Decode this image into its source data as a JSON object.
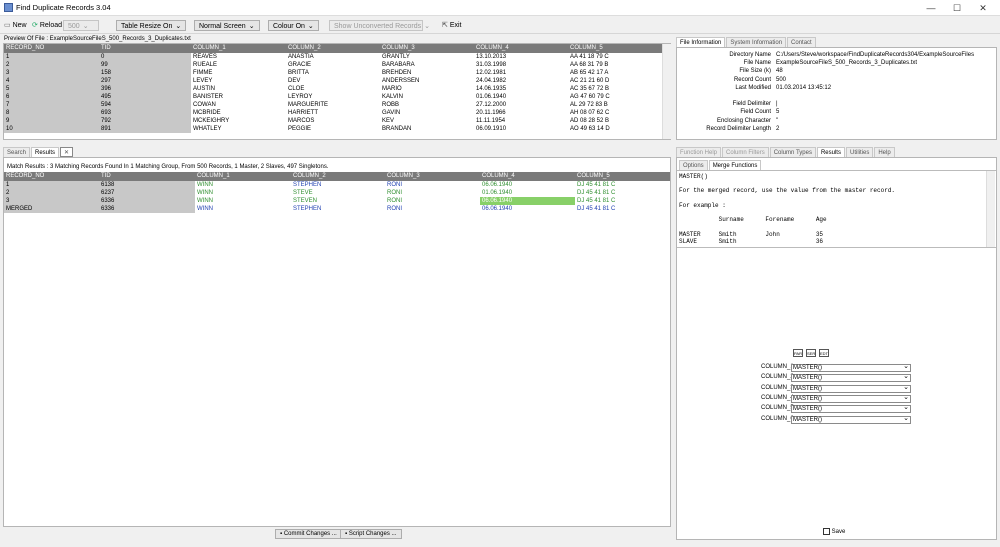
{
  "window": {
    "title": "Find Duplicate Records 3.04",
    "min": "—",
    "max": "☐",
    "close": "✕"
  },
  "toolbar": {
    "new": "New",
    "reload": "Reload",
    "reload_count": "500",
    "table_resize": "Table Resize On",
    "screen": "Normal Screen",
    "colour": "Colour On",
    "unconverted": "Show Unconverted Records",
    "exit": "Exit"
  },
  "preview": {
    "caption": "Preview Of File : ExampleSourceFileS_500_Records_3_Duplicates.txt",
    "columns": [
      "RECORD_NO",
      "TID",
      "COLUMN_1",
      "COLUMN_2",
      "COLUMN_3",
      "COLUMN_4",
      "COLUMN_5"
    ],
    "rows": [
      [
        "1",
        "0",
        "REAVES",
        "ANASTIA",
        "GRANTLY",
        "13.10.2013",
        "AA 41 18 79 C"
      ],
      [
        "2",
        "99",
        "RUEALE",
        "GRACIE",
        "BARABARA",
        "31.03.1998",
        "AA 68 31 79 B"
      ],
      [
        "3",
        "158",
        "FIMME",
        "BRITTA",
        "BREHDEN",
        "12.02.1981",
        "AB 65 42 17 A"
      ],
      [
        "4",
        "297",
        "LEVEY",
        "DEV",
        "ANDERSSEN",
        "24.04.1982",
        "AC 21 21 60 D"
      ],
      [
        "5",
        "396",
        "AUSTIN",
        "CLOE",
        "MARIO",
        "14.06.1935",
        "AC 35 67 72 B"
      ],
      [
        "6",
        "495",
        "BANISTER",
        "LEYROY",
        "KALVIN",
        "01.06.1940",
        "AG 47 60 79 C"
      ],
      [
        "7",
        "594",
        "COWAN",
        "MARGUERITE",
        "ROBB",
        "27.12.2000",
        "AL 29 72 83 B"
      ],
      [
        "8",
        "693",
        "MCBRIDE",
        "HARRIETT",
        "GAVIN",
        "20.11.1966",
        "AH 08 07 62 C"
      ],
      [
        "9",
        "792",
        "MCKEIGHRY",
        "MARCOS",
        "KEV",
        "11.11.1954",
        "AD 08 28 52 B"
      ],
      [
        "10",
        "891",
        "WHATLEY",
        "PEGGIE",
        "BRANDAN",
        "06.09.1910",
        "AO 49 63 14 D"
      ]
    ]
  },
  "info_tabs": [
    "File Information",
    "System Information",
    "Contact"
  ],
  "file_info": [
    [
      "Directory Name",
      "C:/Users/Steve/workspace/FindDuplicateRecords304/ExampleSourceFiles"
    ],
    [
      "File Name",
      "ExampleSourceFileS_500_Records_3_Duplicates.txt"
    ],
    [
      "File Size (k)",
      "48"
    ],
    [
      "Record Count",
      "500"
    ],
    [
      "Last Modified",
      "01.03.2014 13:45:12"
    ],
    [
      "",
      ""
    ],
    [
      "Field Delimiter",
      "|"
    ],
    [
      "Field Count",
      "5"
    ],
    [
      "Enclosing Character",
      "\""
    ],
    [
      "Record Delimiter Length",
      "2"
    ]
  ],
  "results_tabs": [
    "Search",
    "Results"
  ],
  "match_summary": "Match Results :  3  Matching Records Found In   1  Matching Group,  From  500 Records,  1 Master,  2 Slaves,  497 Singletons.",
  "results": {
    "columns": [
      "RECORD_NO",
      "TID",
      "COLUMN_1",
      "COLUMN_2",
      "COLUMN_3",
      "COLUMN_4",
      "COLUMN_5"
    ],
    "rows": [
      [
        "1",
        "6138",
        "WINN",
        "STEPHEN",
        "RONI",
        "06.06.1940",
        "DJ 45 41 81 C"
      ],
      [
        "2",
        "6237",
        "WINN",
        "STEVE",
        "RONI",
        "01.06.1940",
        "DJ 45 41 81 C"
      ],
      [
        "3",
        "6336",
        "WINN",
        "STEVEN",
        "RONI",
        "06.06.1940",
        "DJ 45 41 81 C"
      ],
      [
        "Merged",
        "6336",
        "WINN",
        "STEPHEN",
        "RONI",
        "06.06.1940",
        "DJ 45 41 81 C"
      ]
    ]
  },
  "commit_label": "Commit Changes ...",
  "script_label": "Script Changes ...",
  "right_tabs": [
    "Function Help",
    "Column Filters",
    "Column Types",
    "Results",
    "Utilities",
    "Help"
  ],
  "sub_tabs": [
    "Options",
    "Merge Functions"
  ],
  "help_text": [
    "MASTER()",
    "",
    "For the merged record, use the value from the master record.",
    "",
    "For example :",
    "",
    "           Surname      Forename      Age",
    "",
    "MASTER     Smith        John          35",
    "SLAVE      Smith                      36"
  ],
  "mini_buttons": [
    "PAR",
    "SER",
    "EDT"
  ],
  "merge_rows": [
    {
      "label": "COLUMN_1",
      "value": "MASTER()"
    },
    {
      "label": "COLUMN_2",
      "value": "MASTER()"
    },
    {
      "label": "COLUMN_3",
      "value": "MASTER()"
    },
    {
      "label": "COLUMN_4",
      "value": "MASTER()"
    },
    {
      "label": "COLUMN_5",
      "value": "MASTER()"
    },
    {
      "label": "COLUMN_6",
      "value": "MASTER()"
    }
  ],
  "save_label": "Save",
  "colors": {
    "header": "#7a7a7a",
    "green_text": "#2f8f2f",
    "blue_text": "#1f3fb0",
    "highlight": "#88d068"
  }
}
